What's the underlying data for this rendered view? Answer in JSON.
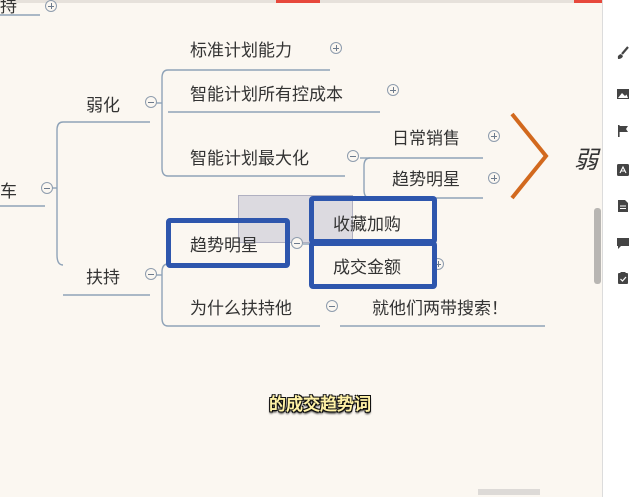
{
  "mindmap": {
    "top_cut_node": "持",
    "root_cut_node": "车",
    "weaken": {
      "label": "弱化",
      "children": [
        "标准计划能力",
        "智能计划所有控成本",
        "智能计划最大化"
      ],
      "max_children": [
        "日常销售",
        "趋势明星"
      ]
    },
    "support": {
      "label": "扶持",
      "children": [
        "趋势明星",
        "为什么扶持他"
      ],
      "trend_children": [
        "收藏加购",
        "成交金额"
      ],
      "why_answer": "就他们两带搜索！"
    },
    "right_cut_label": "弱"
  },
  "subtitle": "的成交趋势词",
  "colors": {
    "canvas_bg": "#fbf7f1",
    "connector": "#8fa3b8",
    "highlight_box": "#2e56ad",
    "chevron": "#d2691e",
    "subtitle_text": "#fff2a6",
    "accent_red": "#e7483c"
  },
  "toolbar_icons": [
    "brush-icon",
    "image-icon",
    "flag-icon",
    "text-icon",
    "document-icon",
    "comment-icon",
    "clipboard-icon"
  ]
}
